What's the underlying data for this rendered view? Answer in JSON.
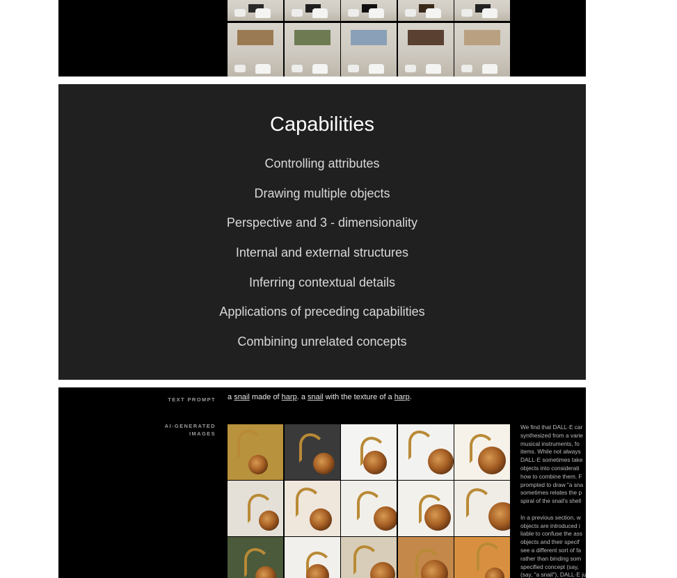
{
  "top_slide": {
    "room_images": [
      {
        "name": "room-image-1",
        "art": "#2a2a2a"
      },
      {
        "name": "room-image-2",
        "art": "#1f1f1f"
      },
      {
        "name": "room-image-3",
        "art": "#111111"
      },
      {
        "name": "room-image-4",
        "art": "#3a2a1a"
      },
      {
        "name": "room-image-5",
        "art": "#222222"
      },
      {
        "name": "room-image-6",
        "art": "#9a7a52"
      },
      {
        "name": "room-image-7",
        "art": "#6e7a52"
      },
      {
        "name": "room-image-8",
        "art": "#8aa0b8"
      },
      {
        "name": "room-image-9",
        "art": "#5a4030"
      },
      {
        "name": "room-image-10",
        "art": "#b8a080"
      }
    ]
  },
  "capabilities": {
    "title": "Capabilities",
    "items": [
      "Controlling attributes",
      "Drawing multiple objects",
      "Perspective and 3 - dimensionality",
      "Internal and external structures",
      "Inferring contextual details",
      "Applications of preceding capabilities",
      "Combining unrelated concepts"
    ]
  },
  "bottom_slide": {
    "text_prompt_label": "TEXT PROMPT",
    "ai_images_label_line1": "AI-GENERATED",
    "ai_images_label_line2": "IMAGES",
    "prompt": {
      "p1": "a ",
      "w1": "snail",
      "p2": " made of ",
      "w2": "harp",
      "p3": ". a ",
      "w3": "snail",
      "p4": " with the texture of a ",
      "w4": "harp",
      "p5": "."
    },
    "side_text": "We find that DALL·E car\nsynthesized from a varie\nmusical instruments, fo\nitems. While not always\nDALL·E sometimes take\nobjects into considerati\nhow to combine them. F\nprompted to draw \"a sna\nsometimes relates the p\nspiral of the snail's shell\n\nIn a previous section, w\nobjects are introduced i\nliable to confuse the ass\nobjects and their specif\nsee a different sort of fa\nrather than binding som\nspecified concept (say,\n(say, \"a snail\"), DALL·E ju",
    "images": [
      {
        "bg": "#b8923c"
      },
      {
        "bg": "#3a3a3a"
      },
      {
        "bg": "#f4f4f2"
      },
      {
        "bg": "#f2f2f0"
      },
      {
        "bg": "#f6f2ea"
      },
      {
        "bg": "#e4e0d8"
      },
      {
        "bg": "#efe6dc"
      },
      {
        "bg": "#f1efe9"
      },
      {
        "bg": "#f3f1ec"
      },
      {
        "bg": "#f0ece6"
      },
      {
        "bg": "#4a5a3a"
      },
      {
        "bg": "#f2f0ec"
      },
      {
        "bg": "#d8cdb8"
      },
      {
        "bg": "#c4884a"
      },
      {
        "bg": "#d89040"
      }
    ]
  }
}
